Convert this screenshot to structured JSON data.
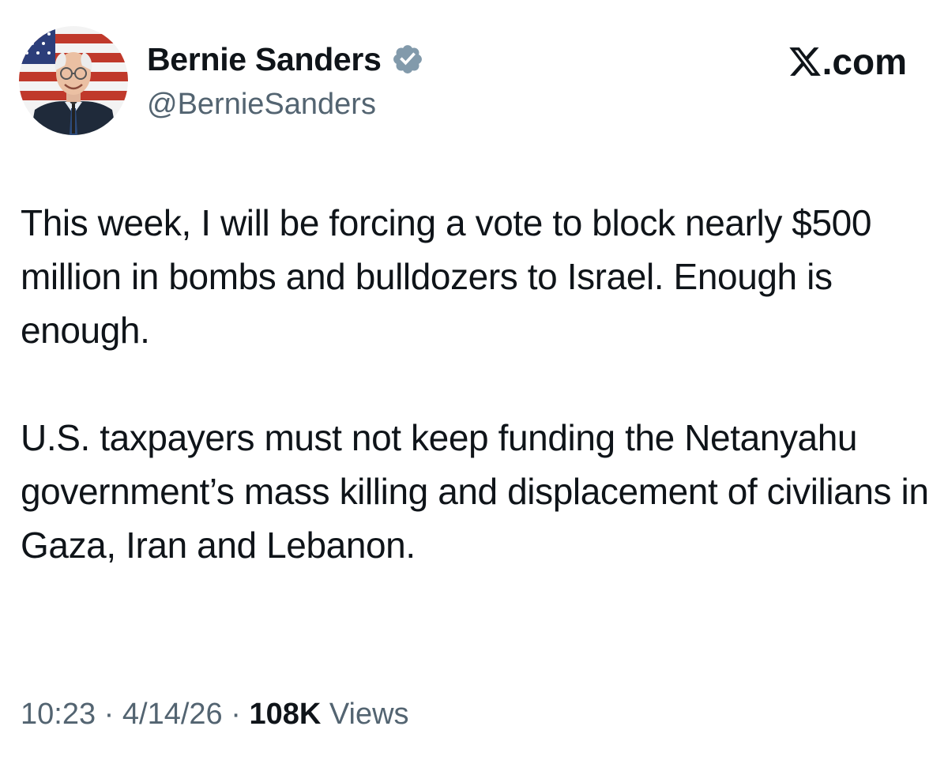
{
  "author": {
    "display_name": "Bernie Sanders",
    "handle": "@BernieSanders",
    "verified": true,
    "avatar_icon": "portrait-flag-avatar"
  },
  "brand": {
    "icon": "x-logo-icon",
    "text": ".com"
  },
  "tweet": {
    "paragraph_1": "This week, I will be forcing a vote to block nearly $500 million in bombs and bulldozers to Israel. Enough is enough.",
    "paragraph_2": "U.S. taxpayers must not keep funding the Netanyahu government’s mass killing and displacement of civilians in Gaza, Iran and Lebanon."
  },
  "meta": {
    "time": "10:23",
    "separator": "·",
    "date": "4/14/26",
    "views_count": "108K",
    "views_label": "Views"
  },
  "colors": {
    "text_primary": "#0f1419",
    "text_secondary": "#536471",
    "verified_badge": "#829aab",
    "background": "#ffffff"
  }
}
